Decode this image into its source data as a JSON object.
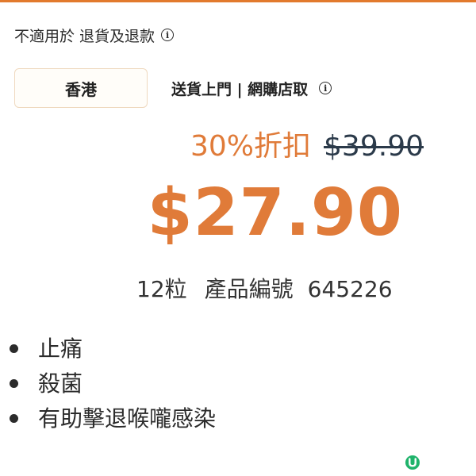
{
  "return_policy": {
    "label": "不適用於 退貨及退款",
    "info_glyph": "i"
  },
  "region_button": {
    "label": "香港"
  },
  "delivery": {
    "label": "送貨上門 | 網購店取",
    "info_glyph": "i"
  },
  "pricing": {
    "discount": "30%折扣",
    "original_price": "$39.90",
    "sale_price": "$27.90"
  },
  "product_meta": {
    "quantity": "12粒",
    "code_label": "產品編號",
    "code_value": "645226"
  },
  "features": [
    "止痛",
    "殺菌",
    "有助擊退喉嚨感染"
  ],
  "colors": {
    "accent": "#e07b39",
    "original_price": "#2b3a4a",
    "logo": "#1fb36b"
  },
  "icons": {
    "info": "info-icon",
    "logo": "u-logo-icon"
  }
}
